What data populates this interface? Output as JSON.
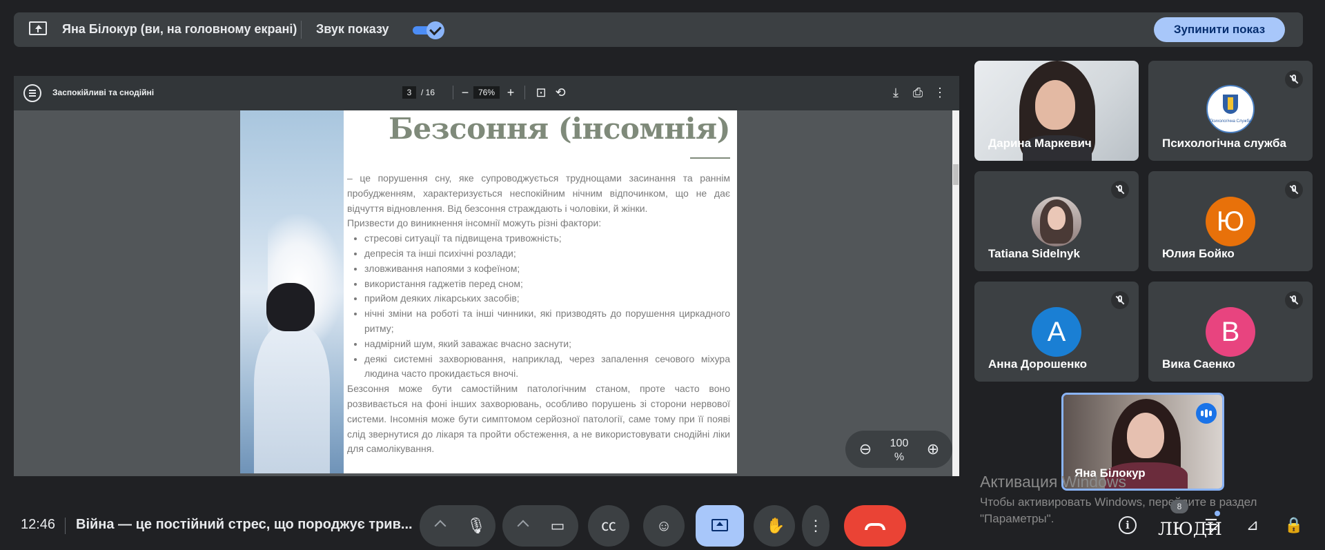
{
  "banner": {
    "title": "Яна Білокур (ви, на головному екрані)",
    "sound_label": "Звук показу",
    "sound_on": true,
    "stop_button": "Зупинити показ"
  },
  "pdf": {
    "title": "Заспокійливі та снодійні",
    "page_current": "3",
    "page_total": "/ 16",
    "zoom": "76%",
    "toolbar_icons": [
      "menu-icon",
      "minus-icon",
      "plus-icon",
      "fit-page-icon",
      "rotate-icon",
      "download-icon",
      "print-icon",
      "more-vert-icon"
    ],
    "page": {
      "heading": "Безсоння (інсомнія)",
      "intro": " – це порушення сну, яке супроводжується труднощами засинання та раннім пробудженням, характеризується неспокійним нічним відпочинком, що не дає відчуття відновлення. Від безсоння страждають і чоловіки, й жінки.",
      "factors_intro": "Призвести до виникнення інсомнії можуть різні фактори:",
      "factors": [
        "стресові ситуації та підвищена тривожність;",
        "депресія та інші психічні розлади;",
        "зловживання напоями з кофеїном;",
        "використання гаджетів перед сном;",
        "прийом деяких лікарських засобів;",
        "нічні зміни на роботі та інші чинники, які призводять до порушення циркадного ритму;",
        "надмірний шум, який заважає вчасно заснути;",
        "деякі системні захворювання, наприклад, через запалення сечового міхура людина часто прокидається вночі."
      ],
      "conclusion": "Безсоння може бути самостійним патологічним станом, проте часто воно розвивається на фоні інших захворювань, особливо порушень зі сторони нервової системи. Інсомнія може бути симптомом серйозної патології, саме тому при її появі слід звернутися до лікаря та пройти обстеження, а не використовувати снодійні ліки для самолікування."
    },
    "overlay_zoom": {
      "value_line1": "100",
      "value_line2": "%"
    }
  },
  "participants": [
    {
      "name": "Дарина Маркевич",
      "type": "video",
      "muted": false
    },
    {
      "name": "Психологічна служба",
      "type": "logo",
      "logo_text": "Психологічна Служба",
      "muted": true
    },
    {
      "name": "Tatiana Sidelnyk",
      "type": "photo",
      "muted": true
    },
    {
      "name": "Юлия Бойко",
      "type": "initial",
      "initial": "Ю",
      "color": "#e8710a",
      "muted": true
    },
    {
      "name": "Анна Дорошенко",
      "type": "initial",
      "initial": "A",
      "color": "#1a7fd4",
      "muted": true
    },
    {
      "name": "Вика Саенко",
      "type": "initial",
      "initial": "B",
      "color": "#e8447f",
      "muted": true
    },
    {
      "name": "Яна Білокур",
      "type": "video",
      "speaking": true,
      "self": true
    }
  ],
  "watermark": {
    "line1": "Активация Windows",
    "line2": "Чтобы активировать Windows, перейдите в раздел",
    "line3": "\"Параметры\"."
  },
  "bottom": {
    "time": "12:46",
    "meeting_title": "Війна — це постійний стрес, що породжує трив...",
    "people_count": "8",
    "people_label": "ЛЮДИ",
    "controls": [
      "mic",
      "camera",
      "captions",
      "emoji",
      "present",
      "raise-hand",
      "more",
      "end-call"
    ],
    "right_icons": [
      "info",
      "people",
      "chat",
      "activities",
      "host-controls"
    ]
  }
}
